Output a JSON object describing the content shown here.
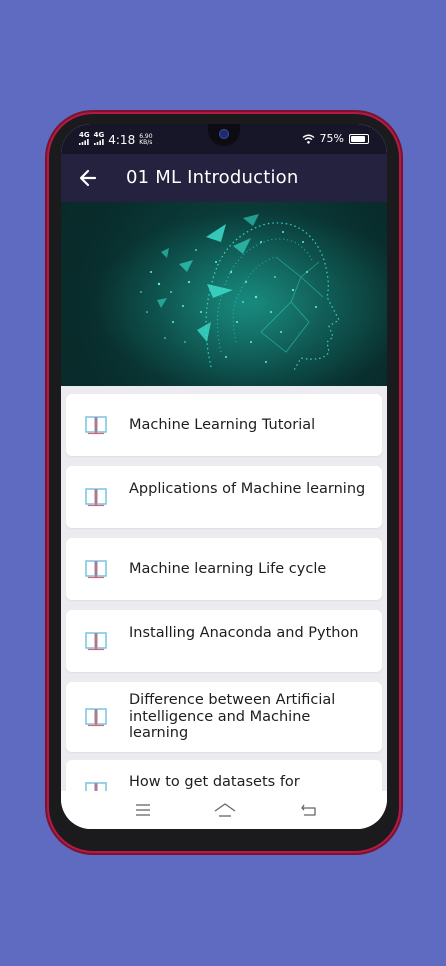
{
  "status": {
    "signal1": "4G",
    "signal2": "4G",
    "time": "4:18",
    "speed_value": "6.90",
    "speed_unit": "KB/s",
    "battery": "75%"
  },
  "header": {
    "title": "01 ML Introduction"
  },
  "icons": {
    "back": "arrow-left-icon",
    "item": "book-icon",
    "nav": [
      "menu-icon",
      "home-icon",
      "back-icon"
    ]
  },
  "colors": {
    "background": "#5f6bc0",
    "app_bar": "#24223e",
    "phone_frame": "#b31b45",
    "book_blue": "#7ec8e3",
    "book_red": "#e2606b"
  },
  "topics": [
    "Machine Learning Tutorial",
    "Applications of Machine learning",
    "Machine learning Life cycle",
    "Installing Anaconda and Python",
    "Difference between Artificial intelligence and Machine learning",
    "How to get datasets for"
  ]
}
